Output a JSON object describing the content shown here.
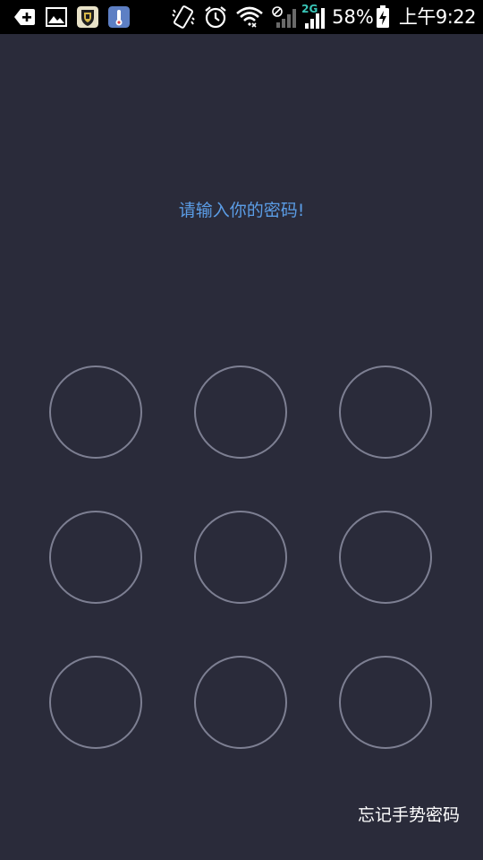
{
  "status_bar": {
    "battery_percent": "58%",
    "time": "上午9:22",
    "network_type": "2G",
    "icons": [
      "add-notification-icon",
      "gallery-icon",
      "app-shield-icon",
      "thermometer-icon",
      "vibrate-icon",
      "alarm-icon",
      "wifi-icon",
      "no-sim-signal-icon",
      "signal-2g-icon",
      "battery-charging-icon"
    ]
  },
  "lock_screen": {
    "prompt": "请输入你的密码!",
    "forgot_label": "忘记手势密码",
    "pattern_dots": [
      1,
      2,
      3,
      4,
      5,
      6,
      7,
      8,
      9
    ]
  },
  "colors": {
    "background": "#2a2b3a",
    "prompt": "#5b9de6",
    "dot_ring": "#7d7f92"
  }
}
